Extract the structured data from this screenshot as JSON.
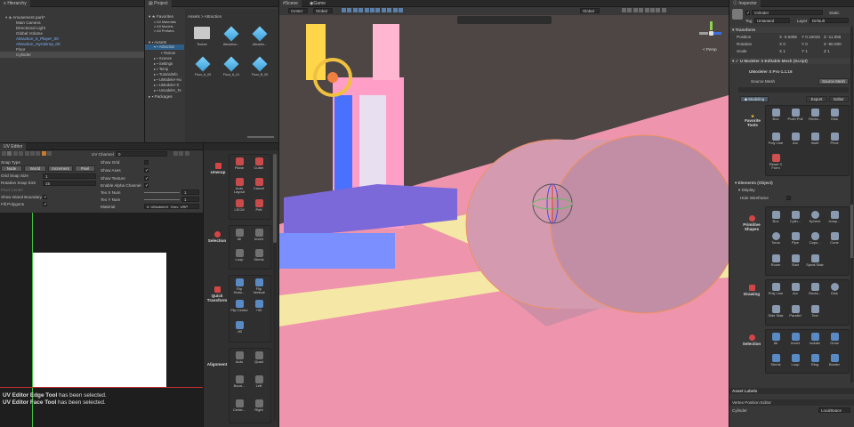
{
  "hierarchy": {
    "tab": "Hierarchy",
    "scene": "Amusement park*",
    "items": [
      "Main Camera",
      "Directional Light",
      "Global Volume",
      "Attraction_5_Player_00",
      "Attraction_GyroDrop_00",
      "Floor",
      "Cylinder"
    ]
  },
  "project": {
    "tab": "Project",
    "favorites_label": "Favorites",
    "favorites": [
      "All Materials",
      "All Models",
      "All Prefabs"
    ],
    "assets_label": "Assets",
    "tree": [
      "Attraction",
      "Texture",
      "Scenes",
      "Settings",
      "Temp",
      "TutorialInfo",
      "UModeler-Hu",
      "UModeler-X",
      "Umodeler_Te"
    ],
    "packages_label": "Packages",
    "breadcrumb": "Assets > Attraction",
    "assets": [
      "Texture",
      "Attraction...",
      "Attractio...",
      "Floor_A_00",
      "Floor_A_01",
      "Floor_B_00"
    ]
  },
  "uv_editor": {
    "tab": "UV Editor",
    "uv_channel_label": "UV Channel",
    "uv_channel_value": "0",
    "snap_type_label": "Snap Type",
    "snap_buttons": [
      "Node",
      "World",
      "Increment",
      "Pixel"
    ],
    "grid_snap_label": "Grid Snap Size",
    "grid_snap_value": "1",
    "rotation_snap_label": "Rotation Snap Size",
    "rotation_snap_value": "15",
    "pixel_center_label": "Pixel Center",
    "show_island_label": "Show Island Boundary",
    "fill_polygons_label": "Fill Polygons",
    "show_grid_label": "Show Grid",
    "show_axes_label": "Show Axes",
    "show_texture_label": "Show Texture",
    "enable_alpha_label": "Enable Alpha Channel",
    "tex_x_label": "Tex X Num",
    "tex_x_value": "1",
    "tex_y_label": "Tex Y Num",
    "tex_y_value": "1",
    "material_label": "Material",
    "material_value": "0: UModelerX_Grey_URP",
    "log": [
      {
        "bold": "UV Editor Edge Tool",
        "rest": " has been selected."
      },
      {
        "bold": "UV Editor Face Tool",
        "rest": " has been selected."
      }
    ]
  },
  "uv_tools": {
    "unwrap": {
      "label": "Unwrap",
      "items": [
        "Plane",
        "Cutter",
        "Auto Layout",
        "Cancel",
        "LSCM",
        "Pelt"
      ]
    },
    "selection": {
      "label": "Selection",
      "items": [
        "All",
        "Invert",
        "Loop",
        "Shrink"
      ]
    },
    "quick_transform": {
      "label": "Quick Transform",
      "items": [
        "Flip Horiz...",
        "Flip Vertical",
        "Flip Center",
        "+90",
        "-90"
      ]
    },
    "alignment": {
      "label": "Alignment",
      "items": [
        "Auto",
        "Quad",
        "Boun...",
        "Left",
        "Cente...",
        "Right"
      ]
    }
  },
  "scene_view": {
    "tabs": [
      "Scene",
      "Game"
    ],
    "pivot": "Center",
    "space": "Global",
    "global2": "Global",
    "persp": "< Persp"
  },
  "inspector": {
    "tab": "Inspector",
    "object_name": "Cylinder",
    "static_label": "Static",
    "tag_label": "Tag",
    "tag_value": "Untagged",
    "layer_label": "Layer",
    "layer_value": "Default",
    "transform_label": "Transform",
    "position_label": "Position",
    "rotation_label": "Rotation",
    "scale_label": "Scale",
    "position": {
      "x": "-0.6385",
      "y": "0.16026",
      "z": "-11.556"
    },
    "rotation": {
      "x": "0",
      "y": "0",
      "z": "-90.000"
    },
    "scale": {
      "x": "1",
      "y": "1",
      "z": "1"
    },
    "component": "U Modeler X Editable Mesh (Script)",
    "version": "UModeler X Pro-1.1.16",
    "source_mesh_label": "Source Mesh",
    "source_mesh_button": "Source Mesh",
    "mode_tabs": [
      "Modeling",
      "Export",
      "Editor"
    ],
    "favorite_tools": {
      "label": "Favorite Tools",
      "items": [
        "Box",
        "Push Pull",
        "Recta...",
        "Disk",
        "Poly Line",
        "Arc",
        "Inset",
        "Pivot",
        "Reset X Form"
      ]
    },
    "elements_label": "Elements (Object)",
    "display_label": "Display",
    "hide_wireframe_label": "Hide Wireframe",
    "primitive_shapes": {
      "label": "Primitive Shapes",
      "items": [
        "Box",
        "Cylin...",
        "Sphere",
        "Icosp...",
        "Torus",
        "Pipe",
        "Caps...",
        "Cone",
        "Room",
        "Stair",
        "Spiral Stair"
      ]
    },
    "drawing": {
      "label": "Drawing",
      "items": [
        "Poly Line",
        "Arc",
        "Recta...",
        "Disk",
        "Side Stair",
        "Parallel",
        "Text"
      ]
    },
    "selection": {
      "label": "Selection",
      "items": [
        "All",
        "Invert",
        "Isolate",
        "Grow",
        "Shrink",
        "Loop",
        "Ring",
        "Border"
      ]
    },
    "asset_labels": "Asset Labels",
    "vertex_editor": "Vertex Position Editor",
    "vertex_object": "Cylinder",
    "vertex_space": "LocalSpace"
  },
  "colors": {
    "accent": "#2c5d87",
    "panel": "#383838",
    "scene_bg": "#4d4645",
    "pink": "#ee94ad",
    "cylinder": "#d49ab0"
  }
}
